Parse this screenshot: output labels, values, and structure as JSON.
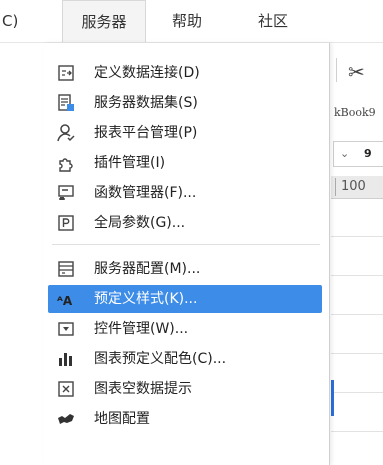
{
  "menubar": {
    "partial_label": "C)",
    "server_label": "服务器",
    "help_label": "帮助",
    "community_label": "社区"
  },
  "background": {
    "book_tab": "kBook9",
    "select_value": "9",
    "ruler_value": "100"
  },
  "menu": {
    "items": [
      {
        "label": "定义数据连接(D)",
        "icon": "database-connection-icon"
      },
      {
        "label": "服务器数据集(S)",
        "icon": "server-dataset-icon"
      },
      {
        "label": "报表平台管理(P)",
        "icon": "user-management-icon"
      },
      {
        "label": "插件管理(I)",
        "icon": "plugin-icon"
      },
      {
        "label": "函数管理器(F)...",
        "icon": "function-manager-icon"
      },
      {
        "label": "全局参数(G)...",
        "icon": "global-parameter-icon"
      },
      {
        "label": "服务器配置(M)...",
        "icon": "server-config-icon"
      },
      {
        "label": "预定义样式(K)...",
        "icon": "predefined-style-icon"
      },
      {
        "label": "控件管理(W)...",
        "icon": "widget-manager-icon"
      },
      {
        "label": "图表预定义配色(C)...",
        "icon": "chart-color-icon"
      },
      {
        "label": "图表空数据提示",
        "icon": "chart-empty-data-icon"
      },
      {
        "label": "地图配置",
        "icon": "map-config-icon"
      }
    ],
    "highlighted_index": 7,
    "highlight_color": "#3d8ce8"
  }
}
